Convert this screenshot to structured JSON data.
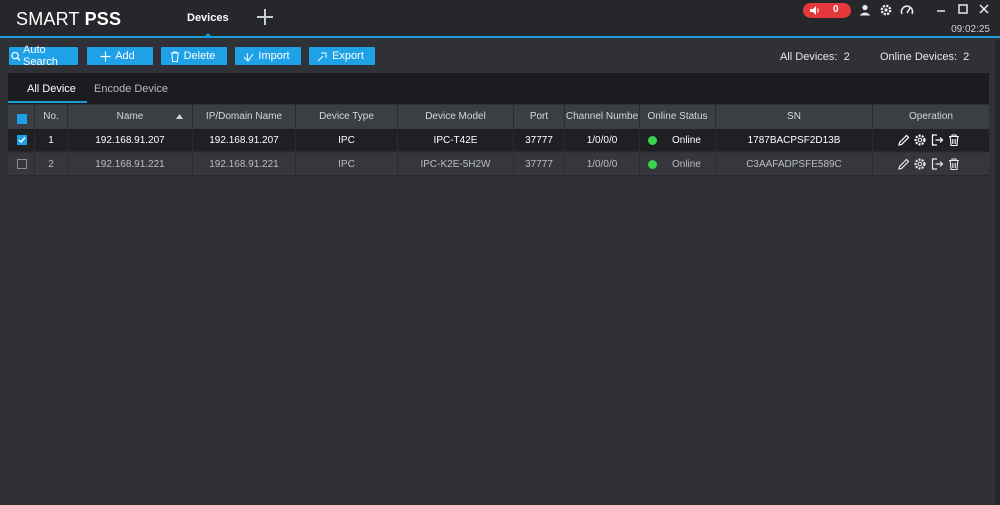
{
  "app": {
    "title_light": "SMART ",
    "title_bold": "PSS",
    "tab": "Devices",
    "clock": "09:02:25",
    "alarm_count": "0"
  },
  "toolbar": {
    "auto_search": "Auto Search",
    "add": "Add",
    "delete": "Delete",
    "import": "Import",
    "export": "Export",
    "all_devices_label": "All Devices:",
    "all_devices_value": "2",
    "online_devices_label": "Online Devices:",
    "online_devices_value": "2"
  },
  "subtabs": {
    "all": "All Device",
    "encode": "Encode Device"
  },
  "table": {
    "columns": [
      "No.",
      "Name",
      "IP/Domain Name",
      "Device Type",
      "Device Model",
      "Port",
      "Channel Numbe",
      "Online Status",
      "SN",
      "Operation"
    ],
    "rows": [
      {
        "checked": true,
        "no": "1",
        "name": "192.168.91.207",
        "ip": "192.168.91.207",
        "type": "IPC",
        "model": "IPC-T42E",
        "port": "37777",
        "channel": "1/0/0/0",
        "status": "Online",
        "sn": "1787BACPSF2D13B"
      },
      {
        "checked": false,
        "no": "2",
        "name": "192.168.91.221",
        "ip": "192.168.91.221",
        "type": "IPC",
        "model": "IPC-K2E-5H2W",
        "port": "37777",
        "channel": "1/0/0/0",
        "status": "Online",
        "sn": "C3AAFADPSFE589C"
      }
    ]
  },
  "colors": {
    "accent": "#1ea1e6",
    "alarm": "#e5383b",
    "online": "#3bd34b"
  },
  "icons": [
    "speaker-icon",
    "user-icon",
    "gear-icon",
    "gauge-icon",
    "minimize-icon",
    "maximize-icon",
    "close-icon",
    "search-icon",
    "plus-icon",
    "trash-icon",
    "import-icon",
    "export-icon",
    "edit-icon",
    "settings-icon",
    "logout-icon",
    "delete-icon",
    "sort-asc-icon"
  ]
}
